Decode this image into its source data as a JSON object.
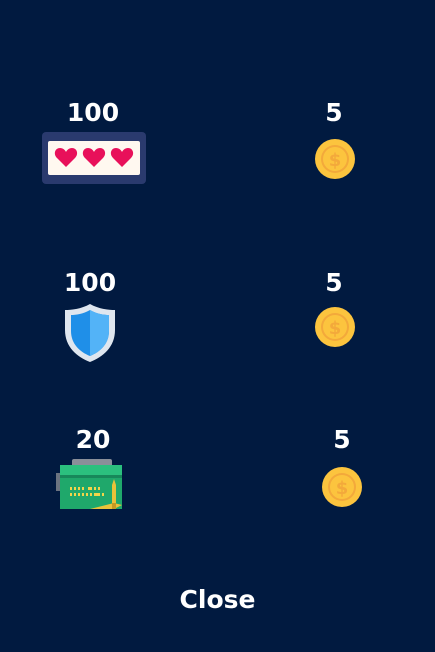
{
  "colors": {
    "background": "#011a40",
    "text": "#ffffff",
    "coin": "#fcc43e",
    "coin_dark": "#f3a93b",
    "heart": "#e8105a",
    "frame": "#2a3a6e",
    "shield_blue": "#1f8fe8",
    "ammo_green": "#1fa86b"
  },
  "items": [
    {
      "name": "hearts",
      "icon": "hearts-icon",
      "amount": "100",
      "price": "5",
      "price_icon": "coin-icon"
    },
    {
      "name": "shield",
      "icon": "shield-icon",
      "amount": "100",
      "price": "5",
      "price_icon": "coin-icon"
    },
    {
      "name": "ammo",
      "icon": "ammo-box-icon",
      "amount": "20",
      "price": "5",
      "price_icon": "coin-icon"
    }
  ],
  "close_label": "Close"
}
